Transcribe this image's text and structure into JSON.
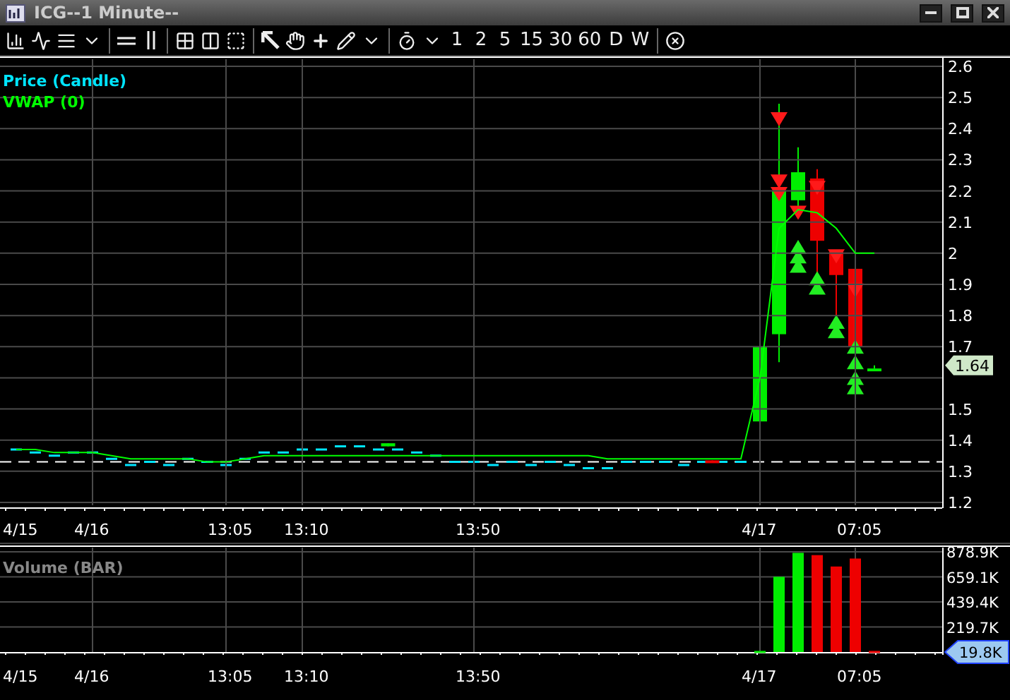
{
  "window": {
    "title": "ICG--1 Minute--"
  },
  "toolbar": {
    "intervals": [
      {
        "label": "1"
      },
      {
        "label": "2"
      },
      {
        "label": "5"
      },
      {
        "label": "15"
      },
      {
        "label": "30"
      },
      {
        "label": "60"
      },
      {
        "label": "D"
      },
      {
        "label": "W"
      }
    ]
  },
  "price_pane": {
    "legend": {
      "label": "Price (Candle)",
      "color": "#00e5ff"
    },
    "last_price": "1.64",
    "chart_data": {
      "type": "line",
      "grid": true,
      "categories": [
        "4/15",
        null,
        null,
        null,
        "4/16",
        null,
        null,
        null,
        null,
        null,
        null,
        "13:05",
        null,
        null,
        null,
        "13:10",
        null,
        null,
        null,
        null,
        null,
        null,
        null,
        null,
        "13:50",
        null,
        null,
        null,
        null,
        null,
        null,
        null,
        null,
        null,
        null,
        null,
        null,
        null,
        null,
        "4/17",
        null,
        null,
        null,
        null,
        "07:05",
        null
      ],
      "ylim": [
        1.2,
        2.6
      ],
      "yticks": [
        1.2,
        1.3,
        1.4,
        1.5,
        1.7,
        1.8,
        1.9,
        2,
        2.1,
        2.2,
        2.3,
        2.4,
        2.5,
        2.6
      ],
      "series": [
        {
          "name": "VWAP (0)",
          "color": "#00ff00",
          "values": [
            1.37,
            1.37,
            1.36,
            1.36,
            1.36,
            1.35,
            1.34,
            1.34,
            1.34,
            1.34,
            1.33,
            1.33,
            1.34,
            1.35,
            1.35,
            1.35,
            1.35,
            1.35,
            1.35,
            1.35,
            1.35,
            1.35,
            1.35,
            1.35,
            1.35,
            1.35,
            1.35,
            1.35,
            1.35,
            1.35,
            1.35,
            1.34,
            1.34,
            1.34,
            1.34,
            1.34,
            1.34,
            1.34,
            1.34,
            1.6,
            2.08,
            2.14,
            2.13,
            2.08,
            2,
            2
          ]
        }
      ]
    }
  },
  "volume_pane": {
    "last_volume": "19.8K",
    "chart_data": {
      "type": "bar",
      "grid": true,
      "categories": [
        "4/15",
        null,
        null,
        null,
        "4/16",
        null,
        null,
        null,
        null,
        null,
        null,
        "13:05",
        null,
        null,
        null,
        "13:10",
        null,
        null,
        null,
        null,
        null,
        null,
        null,
        null,
        "13:50",
        null,
        null,
        null,
        null,
        null,
        null,
        null,
        null,
        null,
        null,
        null,
        null,
        null,
        null,
        "4/17",
        null,
        null,
        null,
        null,
        "07:05",
        null
      ],
      "ylim": [
        0,
        878.9
      ],
      "yticks": [
        {
          "value": 219.7,
          "label": "219.7K"
        },
        {
          "value": 439.4,
          "label": "439.4K"
        },
        {
          "value": 659.1,
          "label": "659.1K"
        },
        {
          "value": 878.9,
          "label": "878.9K"
        }
      ],
      "series": [
        {
          "name": "Volume (BAR)",
          "colors": [
            null,
            null,
            null,
            null,
            null,
            null,
            null,
            null,
            null,
            null,
            null,
            null,
            null,
            null,
            null,
            null,
            null,
            null,
            null,
            null,
            null,
            null,
            null,
            null,
            null,
            null,
            null,
            null,
            null,
            null,
            null,
            null,
            null,
            null,
            null,
            null,
            null,
            null,
            null,
            "#00ee00",
            "#00ee00",
            "#00ee00",
            "#ee0000",
            "#ee0000",
            "#ee0000",
            "#ee0000"
          ],
          "values": [
            null,
            null,
            null,
            null,
            null,
            null,
            null,
            null,
            null,
            null,
            null,
            null,
            null,
            null,
            null,
            null,
            null,
            null,
            null,
            null,
            null,
            null,
            null,
            null,
            null,
            null,
            null,
            null,
            null,
            null,
            null,
            null,
            null,
            null,
            null,
            null,
            null,
            null,
            null,
            10,
            660,
            870,
            850,
            750,
            820,
            10
          ]
        }
      ]
    }
  }
}
